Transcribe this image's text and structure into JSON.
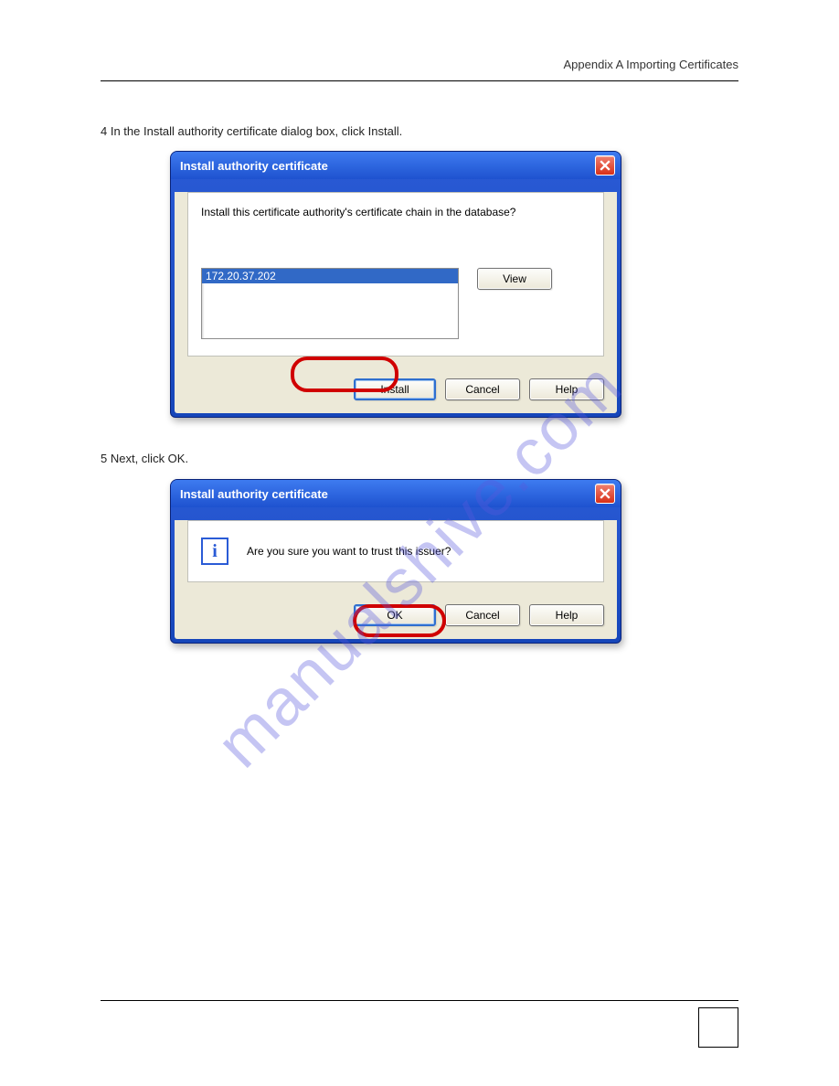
{
  "header": {
    "text": " Appendix A Importing Certificates"
  },
  "instructions": {
    "step4": "4   In the Install authority certificate dialog box, click Install.",
    "step5": "5   Next, click OK."
  },
  "dialog1": {
    "title": "Install authority certificate",
    "prompt": "Install this certificate authority's certificate chain in the database?",
    "list_item": "172.20.37.202",
    "view": "View",
    "install": "Install",
    "cancel": "Cancel",
    "help": "Help"
  },
  "dialog2": {
    "title": "Install authority certificate",
    "prompt": "Are you sure you want to trust this issuer?",
    "ok": "OK",
    "cancel": "Cancel",
    "help": "Help"
  },
  "watermark": "manualshive.com"
}
